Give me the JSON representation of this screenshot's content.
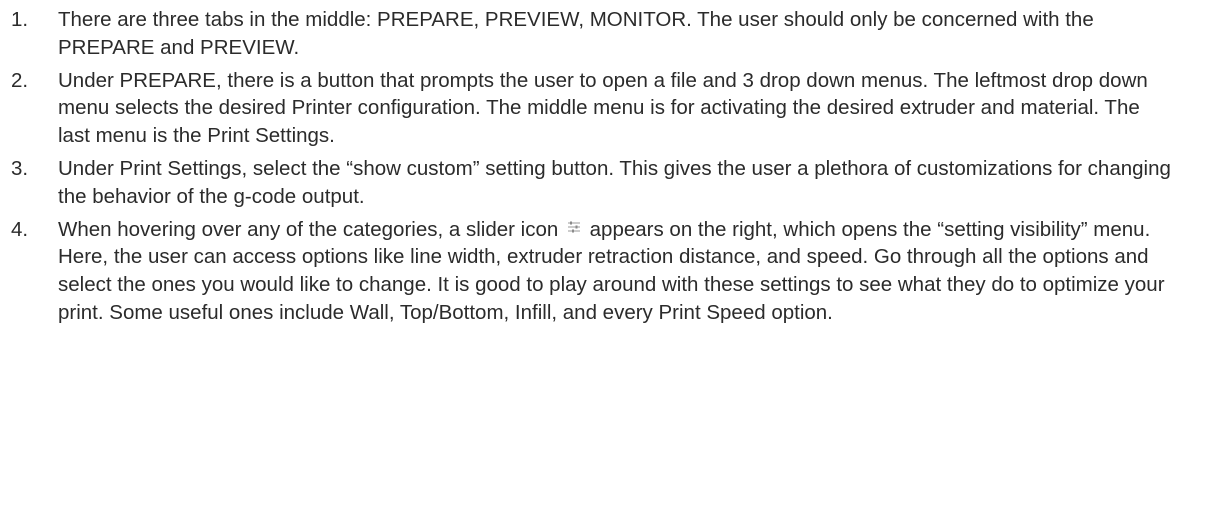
{
  "steps": [
    {
      "number": "1.",
      "text": "There are three tabs in the middle: PREPARE, PREVIEW, MONITOR. The user should only be concerned with the PREPARE and PREVIEW."
    },
    {
      "number": "2.",
      "text": "Under PREPARE, there is a button that prompts the user to open a file and 3 drop down menus. The leftmost drop down menu selects the desired Printer configuration. The middle menu is for activating the desired extruder and material. The last menu is the Print Settings."
    },
    {
      "number": "3.",
      "text": "Under Print Settings, select the “show custom” setting button. This gives the user a plethora of customizations for changing the behavior of the g-code output."
    },
    {
      "number": "4.",
      "text_before_icon": "When hovering over any of the categories, a slider icon",
      "icon": "slider-icon",
      "text_after_icon": "appears on the right, which opens the “setting visibility” menu. Here, the user can access options like line width, extruder retraction distance, and speed. Go through all the options and select the ones you would like to change. It is good to play around with these settings to see what they do to optimize your print. Some useful ones include Wall, Top/Bottom, Infill, and every Print Speed option."
    }
  ]
}
